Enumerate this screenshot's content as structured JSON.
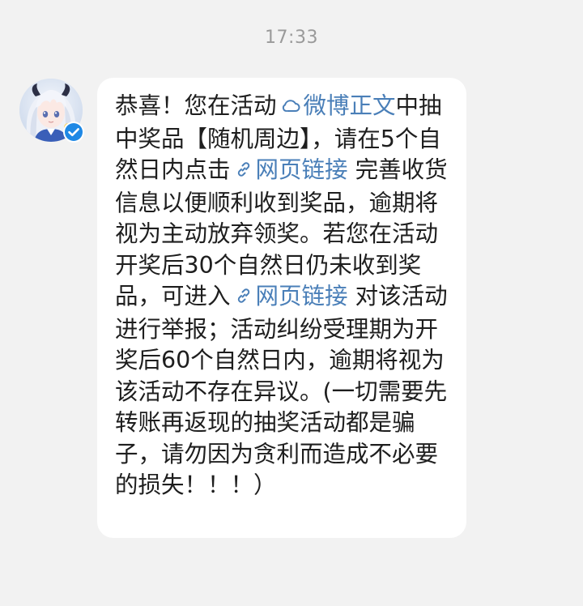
{
  "header": {
    "time": "17:33"
  },
  "message": {
    "sender": {
      "avatar_icon": "anime-girl-avatar-icon",
      "verified_icon": "verified-check-badge-icon",
      "verified_color": "#1e88e5"
    },
    "segments": {
      "s1": "恭喜！您在活动",
      "link1_icon": "weibo-cloud-icon",
      "link1": "微博正文",
      "s2": "中抽中奖品【随机周边】，请在5个自然日内点击",
      "link2_icon": "chain-link-icon",
      "link2": "网页链接",
      "s3": " 完善收货信息以便顺利收到奖品，逾期将视为主动放弃领奖。若您在活动开奖后30个自然日仍未收到奖品，可进入",
      "link3_icon": "chain-link-icon",
      "link3": "网页链接",
      "s4": " 对该活动进行举报；活动纠纷受理期为开奖后60个自然日内，逾期将视为该活动不存在异议。(一切需要先转账再返现的抽奖活动都是骗子，请勿因为贪利而造成不必要的损失！！！）"
    },
    "link_color": "#4a7fb8",
    "bubble_color": "#ffffff",
    "background_color": "#f2f2f2"
  }
}
